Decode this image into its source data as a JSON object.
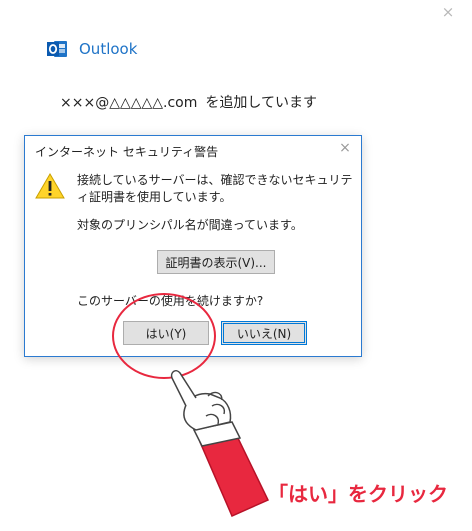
{
  "window": {
    "close_glyph": "×"
  },
  "brand": {
    "name": "Outlook",
    "icon": "outlook-logo-icon",
    "color": "#1e73c7"
  },
  "status": {
    "account": "×××@△△△△△.com",
    "suffix": "を追加しています"
  },
  "dialog": {
    "title": "インターネット セキュリティ警告",
    "close_glyph": "×",
    "warning_icon": "warning-icon",
    "message": "接続しているサーバーは、確認できないセキュリティ証明書を使用しています。",
    "principal_message": "対象のプリンシパル名が間違っています。",
    "view_cert_label": "証明書の表示(V)...",
    "question": "このサーバーの使用を続けますか?",
    "yes_label": "はい(Y)",
    "no_label": "いいえ(N)"
  },
  "annotation": {
    "callout": "「はい」をクリック",
    "hand_icon": "pointing-hand-icon",
    "accent_color": "#e8283f"
  }
}
